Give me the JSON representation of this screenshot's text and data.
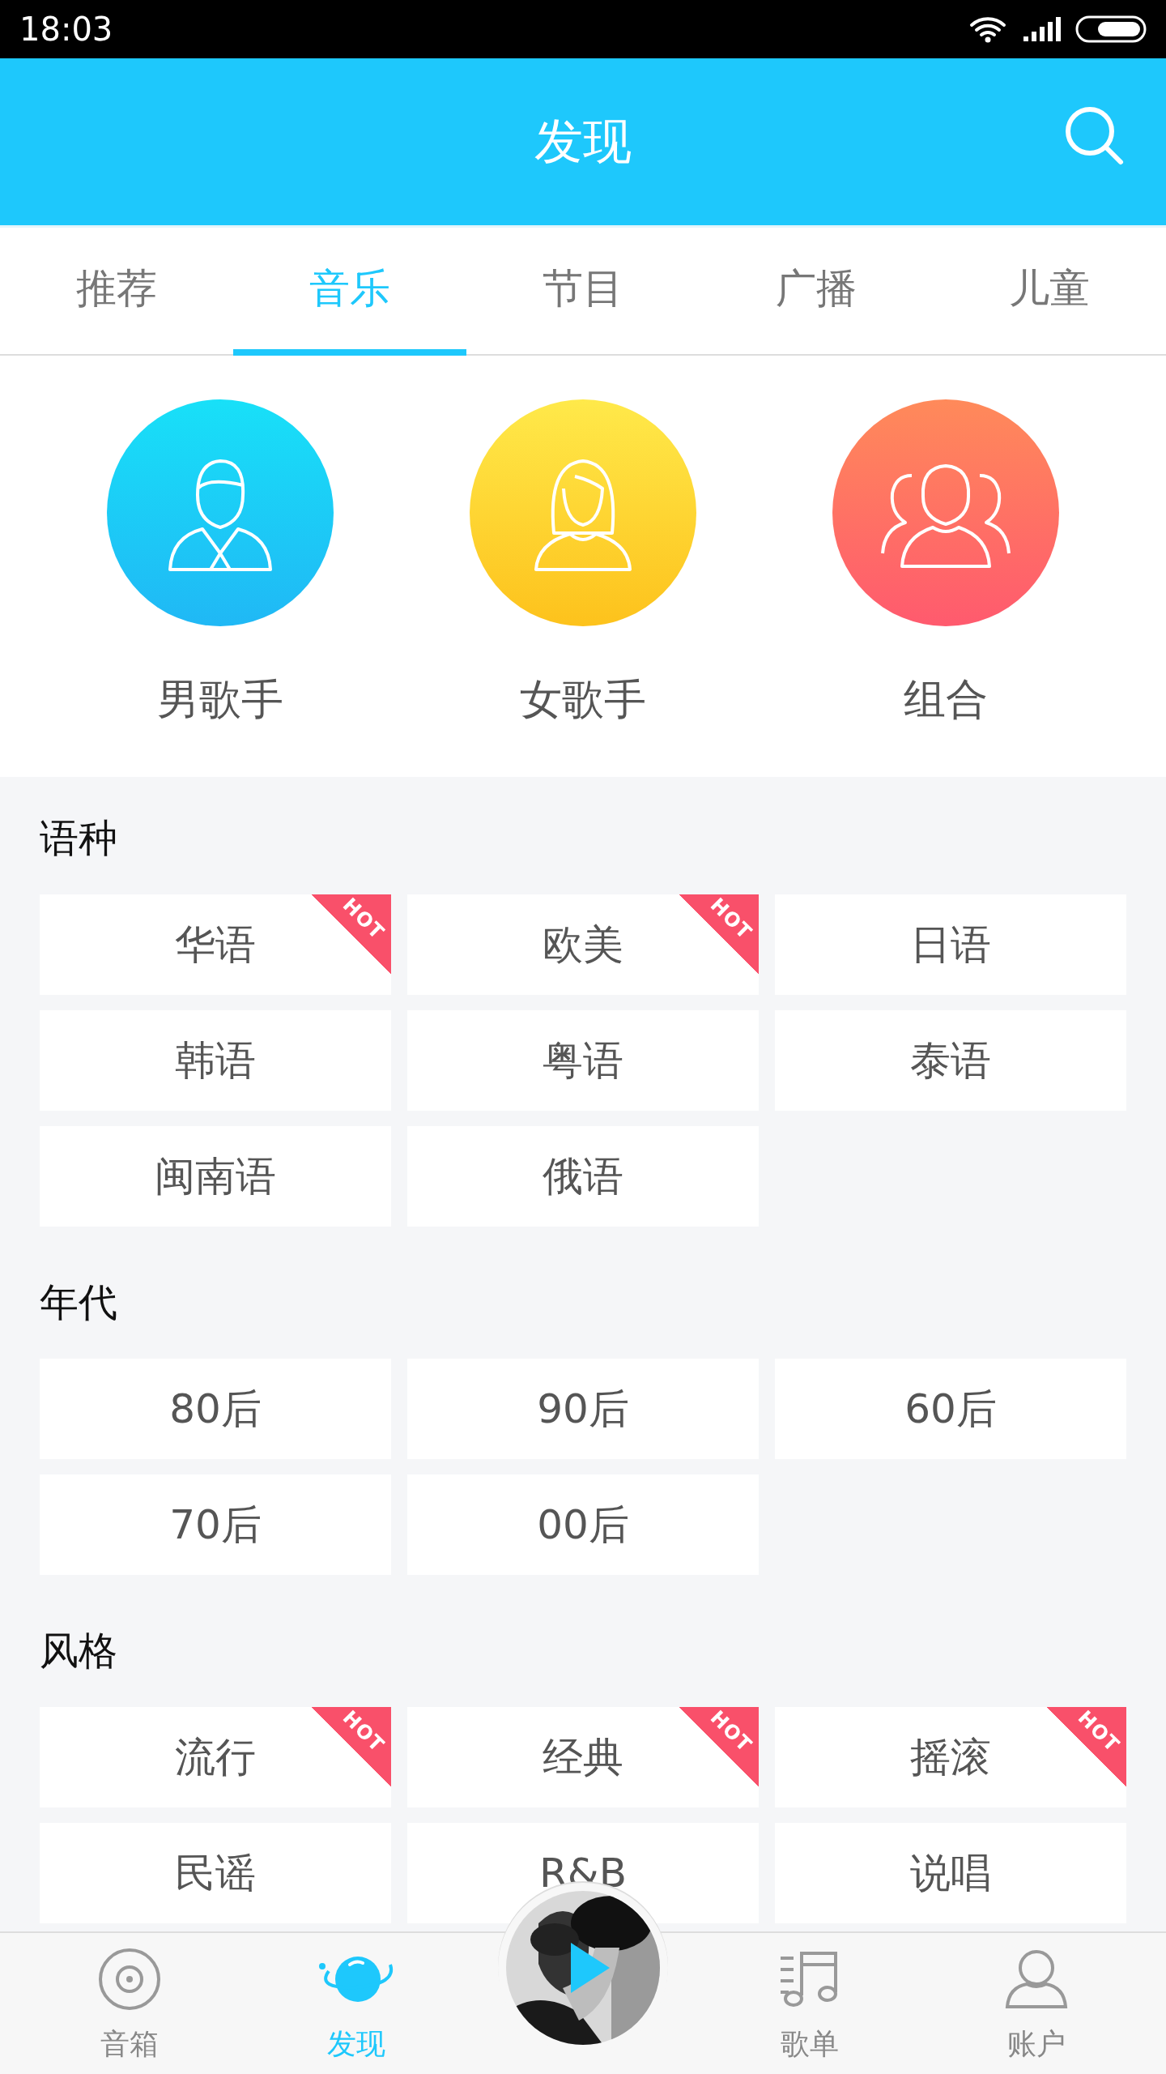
{
  "status_bar": {
    "time": "18:03"
  },
  "header": {
    "title": "发现"
  },
  "tabs": [
    {
      "label": "推荐",
      "selected": false
    },
    {
      "label": "音乐",
      "selected": true
    },
    {
      "label": "节目",
      "selected": false
    },
    {
      "label": "广播",
      "selected": false
    },
    {
      "label": "儿童",
      "selected": false
    }
  ],
  "singers": [
    {
      "label": "男歌手",
      "kind": "male"
    },
    {
      "label": "女歌手",
      "kind": "female"
    },
    {
      "label": "组合",
      "kind": "group"
    }
  ],
  "sections": [
    {
      "title": "语种",
      "tags": [
        {
          "label": "华语",
          "badge": "HOT"
        },
        {
          "label": "欧美",
          "badge": "HOT"
        },
        {
          "label": "日语"
        },
        {
          "label": "韩语"
        },
        {
          "label": "粤语"
        },
        {
          "label": "泰语"
        },
        {
          "label": "闽南语"
        },
        {
          "label": "俄语"
        }
      ]
    },
    {
      "title": "年代",
      "tags": [
        {
          "label": "80后"
        },
        {
          "label": "90后"
        },
        {
          "label": "60后"
        },
        {
          "label": "70后"
        },
        {
          "label": "00后"
        }
      ]
    },
    {
      "title": "风格",
      "tags": [
        {
          "label": "流行",
          "badge": "HOT"
        },
        {
          "label": "经典",
          "badge": "HOT"
        },
        {
          "label": "摇滚",
          "badge": "HOT"
        },
        {
          "label": "民谣"
        },
        {
          "label": "R&B"
        },
        {
          "label": "说唱"
        }
      ]
    }
  ],
  "bottom_nav": [
    {
      "label": "音箱",
      "kind": "speaker",
      "selected": false
    },
    {
      "label": "发现",
      "kind": "planet",
      "selected": true
    },
    {
      "kind": "player"
    },
    {
      "label": "歌单",
      "kind": "playlist",
      "selected": false
    },
    {
      "label": "账户",
      "kind": "account",
      "selected": false
    }
  ]
}
